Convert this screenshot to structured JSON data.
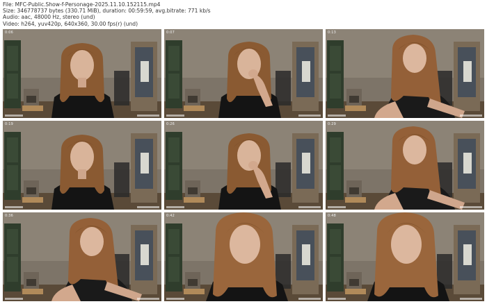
{
  "file_info": {
    "file": "File: MFC-Public.Show-f-Personage-2025.11.10.152115.mp4",
    "size": "Size: 346778737 bytes (330.71 MiB), duration: 00:59:59, avg.bitrate: 771 kb/s",
    "audio": "Audio: aac, 48000 Hz, stereo (und)",
    "video": "Video: h264, yuv420p, 640x360, 30.00 fps(r) (und)"
  },
  "frames": [
    {
      "pose": "front",
      "timestamp": "0:06"
    },
    {
      "pose": "hand",
      "timestamp": "0:07"
    },
    {
      "pose": "lean",
      "timestamp": "0:13"
    },
    {
      "pose": "front",
      "timestamp": "0:19"
    },
    {
      "pose": "hand",
      "timestamp": "0:26"
    },
    {
      "pose": "lean",
      "timestamp": "0:29"
    },
    {
      "pose": "lean",
      "timestamp": "0:36"
    },
    {
      "pose": "close",
      "timestamp": "0:42"
    },
    {
      "pose": "close",
      "timestamp": "0:48"
    }
  ]
}
